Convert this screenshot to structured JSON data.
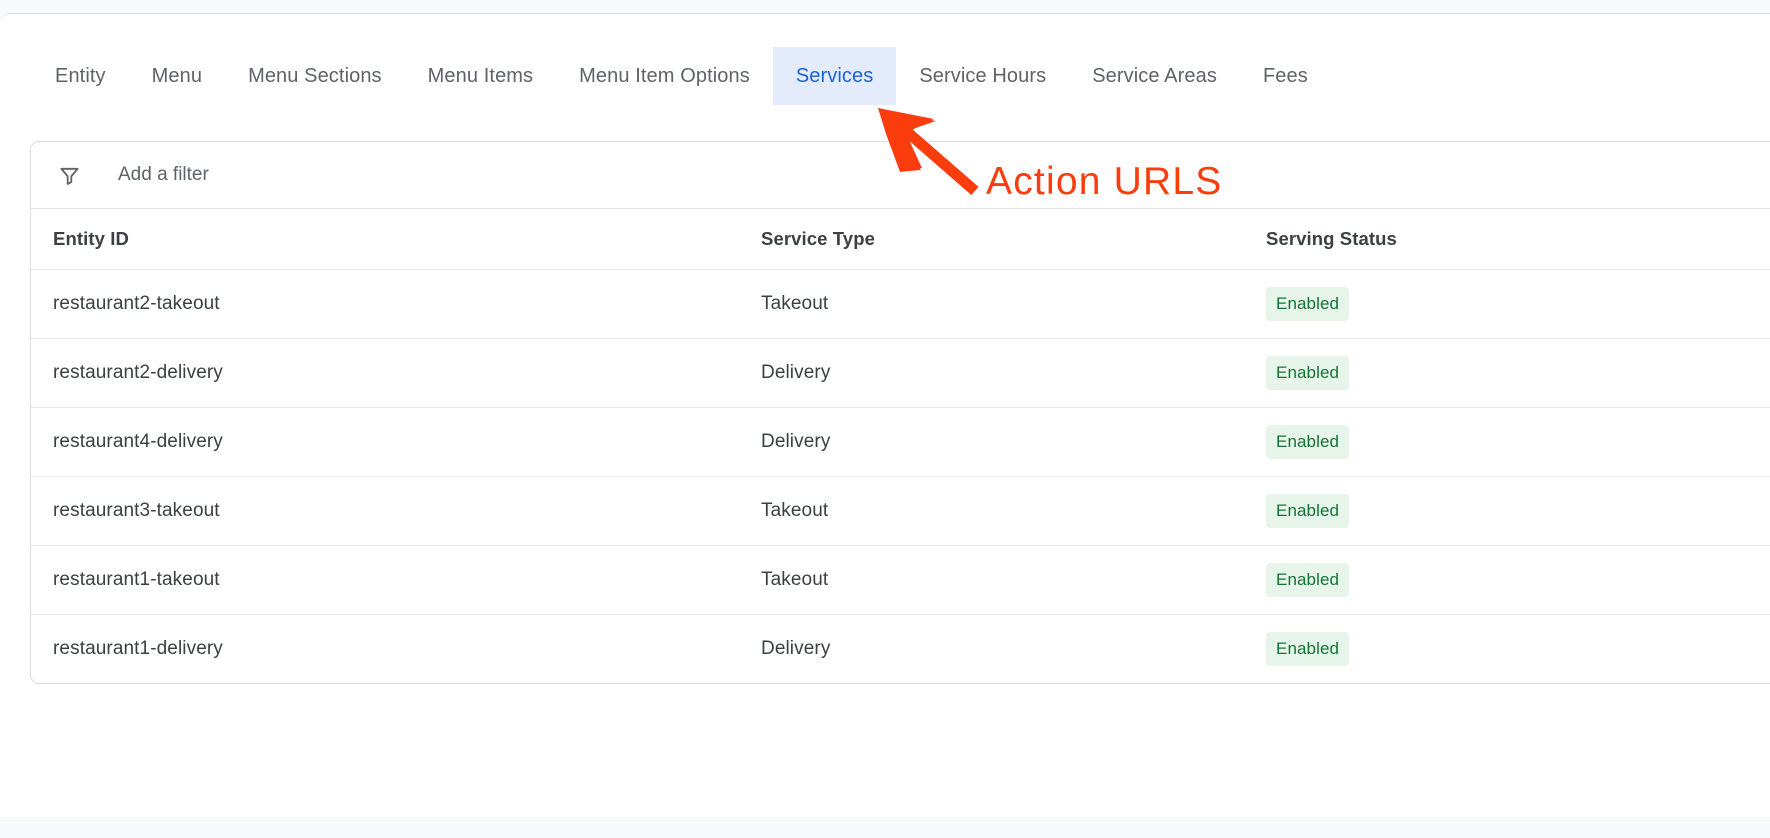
{
  "tabs": [
    {
      "label": "Entity",
      "active": false
    },
    {
      "label": "Menu",
      "active": false
    },
    {
      "label": "Menu Sections",
      "active": false
    },
    {
      "label": "Menu Items",
      "active": false
    },
    {
      "label": "Menu Item Options",
      "active": false
    },
    {
      "label": "Services",
      "active": true
    },
    {
      "label": "Service Hours",
      "active": false
    },
    {
      "label": "Service Areas",
      "active": false
    },
    {
      "label": "Fees",
      "active": false
    }
  ],
  "filter": {
    "icon": "filter-funnel-icon",
    "placeholder": "Add a filter",
    "value": ""
  },
  "table": {
    "columns": [
      "Entity ID",
      "Service Type",
      "Serving Status"
    ],
    "rows": [
      {
        "entity_id": "restaurant2-takeout",
        "service_type": "Takeout",
        "serving_status": "Enabled"
      },
      {
        "entity_id": "restaurant2-delivery",
        "service_type": "Delivery",
        "serving_status": "Enabled"
      },
      {
        "entity_id": "restaurant4-delivery",
        "service_type": "Delivery",
        "serving_status": "Enabled"
      },
      {
        "entity_id": "restaurant3-takeout",
        "service_type": "Takeout",
        "serving_status": "Enabled"
      },
      {
        "entity_id": "restaurant1-takeout",
        "service_type": "Takeout",
        "serving_status": "Enabled"
      },
      {
        "entity_id": "restaurant1-delivery",
        "service_type": "Delivery",
        "serving_status": "Enabled"
      }
    ]
  },
  "annotation": {
    "text": "Action URLS",
    "color": "#fb3c0d",
    "arrow_icon": "arrow-pointing-up-left-icon"
  },
  "colors": {
    "accent_blue": "#1a62d6",
    "active_tab_bg": "#e3ebfd",
    "active_tab_underline": "#1a4fa0",
    "badge_bg": "#e6f4ea",
    "badge_text": "#137333",
    "annotation_red": "#fb3c0d",
    "page_bg": "#f8f9fa",
    "border": "#dadce0"
  }
}
